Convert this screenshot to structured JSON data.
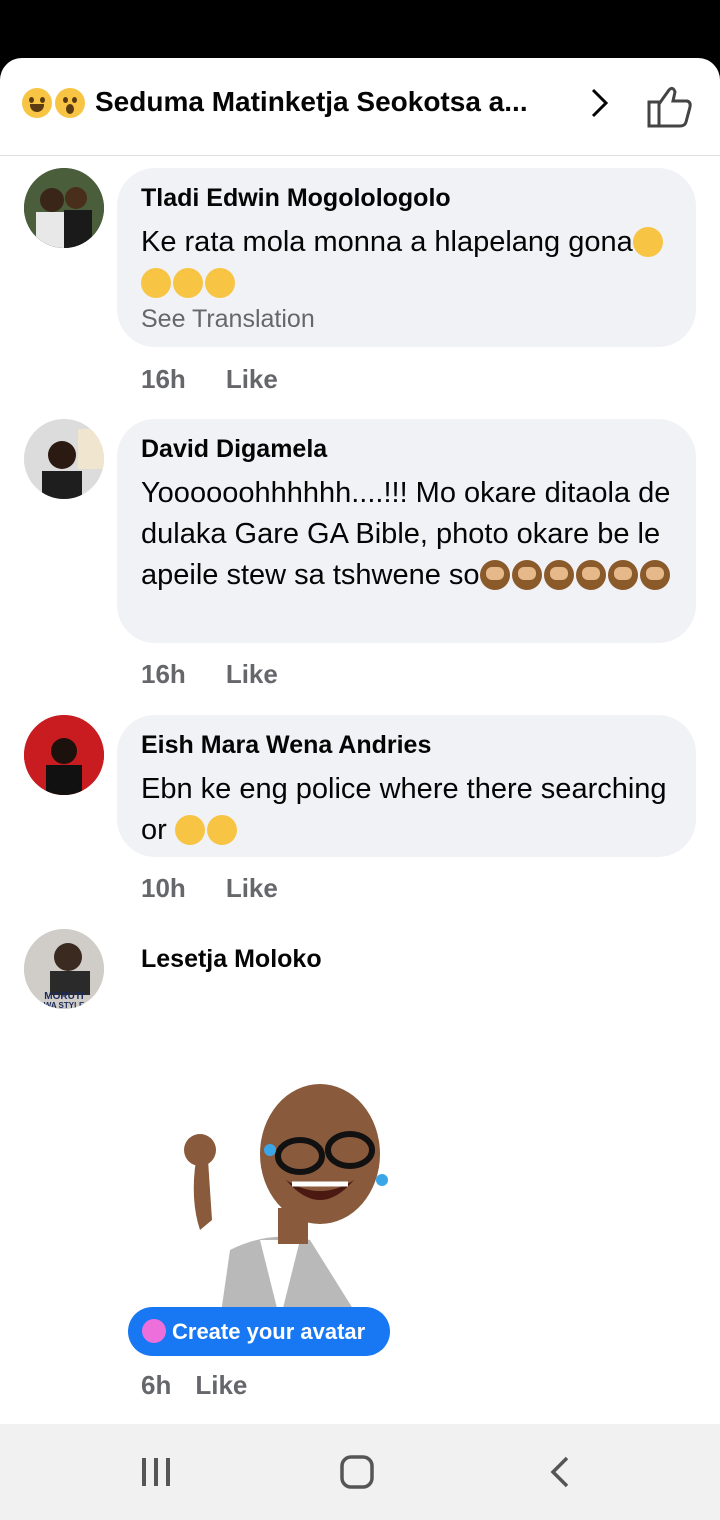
{
  "header": {
    "title": "Seduma Matinketja Seokotsa a...",
    "emoji_icons": [
      "laughing-face-icon",
      "astonished-face-icon"
    ],
    "chevron_icon": "chevron-right-icon",
    "like_icon": "thumbs-up-icon"
  },
  "comments": [
    {
      "author": "Tladi Edwin Mogolologolo",
      "text": "Ke rata  mola  monna  a hlapelang gona",
      "emoji_icon": "rolling-on-floor-laughing-icon",
      "emoji_count": 4,
      "see_translation": "See Translation",
      "time": "16h",
      "like": "Like"
    },
    {
      "author": "David Digamela",
      "text": "Yoooooohhhhhh....!!! Mo okare ditaola de dulaka Gare GA Bible, photo okare be le apeile stew sa tshwene so",
      "emoji_icon": "see-no-evil-monkey-icon",
      "emoji_count": 6,
      "time": "16h",
      "like": "Like"
    },
    {
      "author": "Eish Mara Wena Andries",
      "text": "Ebn ke eng police where there searching or ",
      "emoji_icon": "thinking-face-icon",
      "emoji_count": 2,
      "time": "10h",
      "like": "Like"
    },
    {
      "author": "Lesetja Moloko",
      "avatar_text": [
        "MORUTI",
        "WA STYLE"
      ],
      "sticker_icon": "avatar-sticker-laughing-waving-icon",
      "cta_label": "Create your avatar",
      "time": "6h",
      "like": "Like"
    }
  ],
  "navbar": {
    "recents_icon": "recents-icon",
    "home_icon": "home-icon",
    "back_icon": "back-icon"
  },
  "colors": {
    "accent": "#1877f2",
    "bubble": "#f0f2f5",
    "muted_text": "#65676b"
  }
}
